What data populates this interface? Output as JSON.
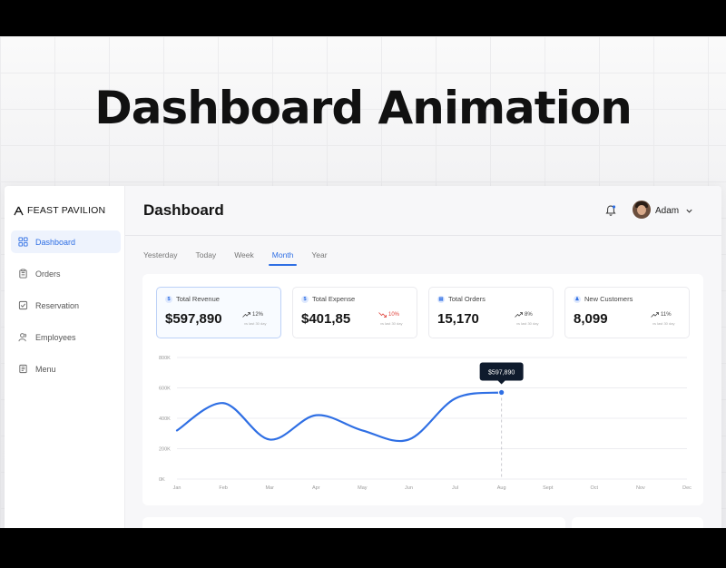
{
  "hero": {
    "title": "Dashboard Animation"
  },
  "brand": {
    "name": "FEAST PAVILION"
  },
  "nav": {
    "items": [
      {
        "label": "Dashboard",
        "icon": "grid-icon"
      },
      {
        "label": "Orders",
        "icon": "clipboard-icon"
      },
      {
        "label": "Reservation",
        "icon": "check-square-icon"
      },
      {
        "label": "Employees",
        "icon": "users-icon"
      },
      {
        "label": "Menu",
        "icon": "menu-doc-icon"
      }
    ],
    "active": 0
  },
  "header": {
    "title": "Dashboard",
    "user_name": "Adam"
  },
  "tabs": {
    "items": [
      "Yesterday",
      "Today",
      "Week",
      "Month",
      "Year"
    ],
    "active": 3
  },
  "kpis": [
    {
      "label": "Total Revenue",
      "icon_glyph": "$",
      "value": "$597,890",
      "change": "12%",
      "direction": "up",
      "sub": "vs last 30 day"
    },
    {
      "label": "Total Expense",
      "icon_glyph": "$",
      "value": "$401,85",
      "change": "10%",
      "direction": "down",
      "sub": "vs last 30 day"
    },
    {
      "label": "Total Orders",
      "icon_glyph": "▤",
      "value": "15,170",
      "change": "8%",
      "direction": "up",
      "sub": "vs last 30 day"
    },
    {
      "label": "New Customers",
      "icon_glyph": "♟",
      "value": "8,099",
      "change": "11%",
      "direction": "up",
      "sub": "vs last 30 day"
    }
  ],
  "colors": {
    "accent": "#2f6fe4",
    "down": "#e0423b",
    "tooltip_bg": "#0f1b2d"
  },
  "chart_data": {
    "type": "line",
    "categories": [
      "Jan",
      "Feb",
      "Mar",
      "Apr",
      "May",
      "Jun",
      "Jul",
      "Aug",
      "Sept",
      "Oct",
      "Nov",
      "Dec"
    ],
    "y_tick_labels": [
      "0K",
      "200K",
      "400K",
      "600K",
      "800K"
    ],
    "series": [
      {
        "values": [
          320000,
          500000,
          260000,
          420000,
          320000,
          260000,
          530000,
          570000
        ]
      }
    ],
    "ylim": [
      0,
      800000
    ],
    "grid": true,
    "tooltip": {
      "category": "Aug",
      "label": "$597,890"
    }
  }
}
